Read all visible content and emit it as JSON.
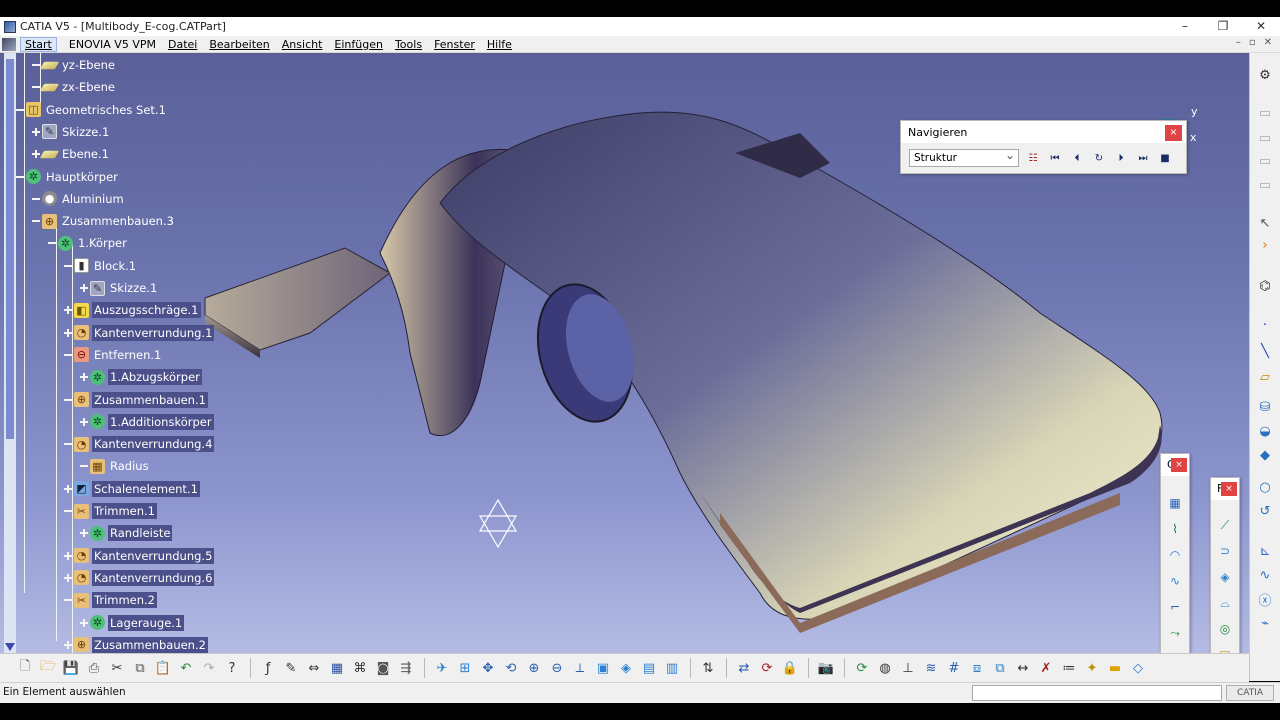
{
  "window": {
    "title": "CATIA V5 - [Multibody_E-cog.CATPart]",
    "buttons": [
      "–",
      "❐",
      "✕"
    ]
  },
  "menu": {
    "items": [
      "Start",
      "ENOVIA V5 VPM",
      "Datei",
      "Bearbeiten",
      "Ansicht",
      "Einfügen",
      "Tools",
      "Fenster",
      "Hilfe"
    ],
    "mdi_buttons": [
      "–",
      "▫",
      "✕"
    ]
  },
  "tree": {
    "nodes": [
      {
        "label": "yz-Ebene",
        "icon": "plane-icon",
        "selected": false
      },
      {
        "label": "zx-Ebene",
        "icon": "plane-icon",
        "selected": false
      },
      {
        "label": "Geometrisches Set.1",
        "icon": "geometrical-set-icon",
        "selected": false
      },
      {
        "label": "Skizze.1",
        "icon": "sketch-icon",
        "selected": false
      },
      {
        "label": "Ebene.1",
        "icon": "plane-icon",
        "selected": false
      },
      {
        "label": "Hauptkörper",
        "icon": "body-gear-icon",
        "selected": false
      },
      {
        "label": "Aluminium",
        "icon": "material-icon",
        "selected": false
      },
      {
        "label": "Zusammenbauen.3",
        "icon": "assemble-icon",
        "selected": false
      },
      {
        "label": "1.Körper",
        "icon": "body-gear-icon",
        "selected": false
      },
      {
        "label": "Block.1",
        "icon": "pad-icon",
        "selected": false
      },
      {
        "label": "Skizze.1",
        "icon": "sketch-icon",
        "selected": false
      },
      {
        "label": "Auszugsschräge.1",
        "icon": "draft-icon",
        "selected": true
      },
      {
        "label": "Kantenverrundung.1",
        "icon": "fillet-icon",
        "selected": true
      },
      {
        "label": "Entfernen.1",
        "icon": "remove-icon",
        "selected": false
      },
      {
        "label": "1.Abzugskörper",
        "icon": "body-gear-icon",
        "selected": true
      },
      {
        "label": "Zusammenbauen.1",
        "icon": "assemble-icon",
        "selected": true
      },
      {
        "label": "1.Additionskörper",
        "icon": "body-gear-icon",
        "selected": true
      },
      {
        "label": "Kantenverrundung.4",
        "icon": "fillet-icon",
        "selected": true
      },
      {
        "label": "Radius",
        "icon": "parameter-icon",
        "selected": false
      },
      {
        "label": "Schalenelement.1",
        "icon": "shell-icon",
        "selected": true
      },
      {
        "label": "Trimmen.1",
        "icon": "trim-icon",
        "selected": true
      },
      {
        "label": "Randleiste",
        "icon": "body-gear-icon",
        "selected": true
      },
      {
        "label": "Kantenverrundung.5",
        "icon": "fillet-icon",
        "selected": true
      },
      {
        "label": "Kantenverrundung.6",
        "icon": "fillet-icon",
        "selected": true
      },
      {
        "label": "Trimmen.2",
        "icon": "trim-icon",
        "selected": true
      },
      {
        "label": "Lagerauge.1",
        "icon": "body-gear-icon",
        "selected": true
      },
      {
        "label": "Zusammenbauen.2",
        "icon": "assemble-icon",
        "selected": true
      }
    ]
  },
  "navigator": {
    "title": "Navigieren",
    "close": "×",
    "mode": "Struktur",
    "buttons": [
      "tree-icon",
      "first-icon",
      "previous-icon",
      "play-icon",
      "next-icon",
      "last-icon",
      "stop-icon"
    ]
  },
  "compass": {
    "y_label": "y",
    "x_label": "x"
  },
  "floatbar1": {
    "title": "C",
    "close": "×"
  },
  "floatbar2": {
    "title": "F",
    "close": "×"
  },
  "status": {
    "message": "Ein Element auswählen"
  },
  "logo": {
    "text": "CATIA"
  },
  "colors": {
    "viewport_top": "#5a5f98",
    "viewport_bottom": "#b4bce4",
    "tree_selection": "#4b4f8a",
    "close_red": "#e04343"
  }
}
